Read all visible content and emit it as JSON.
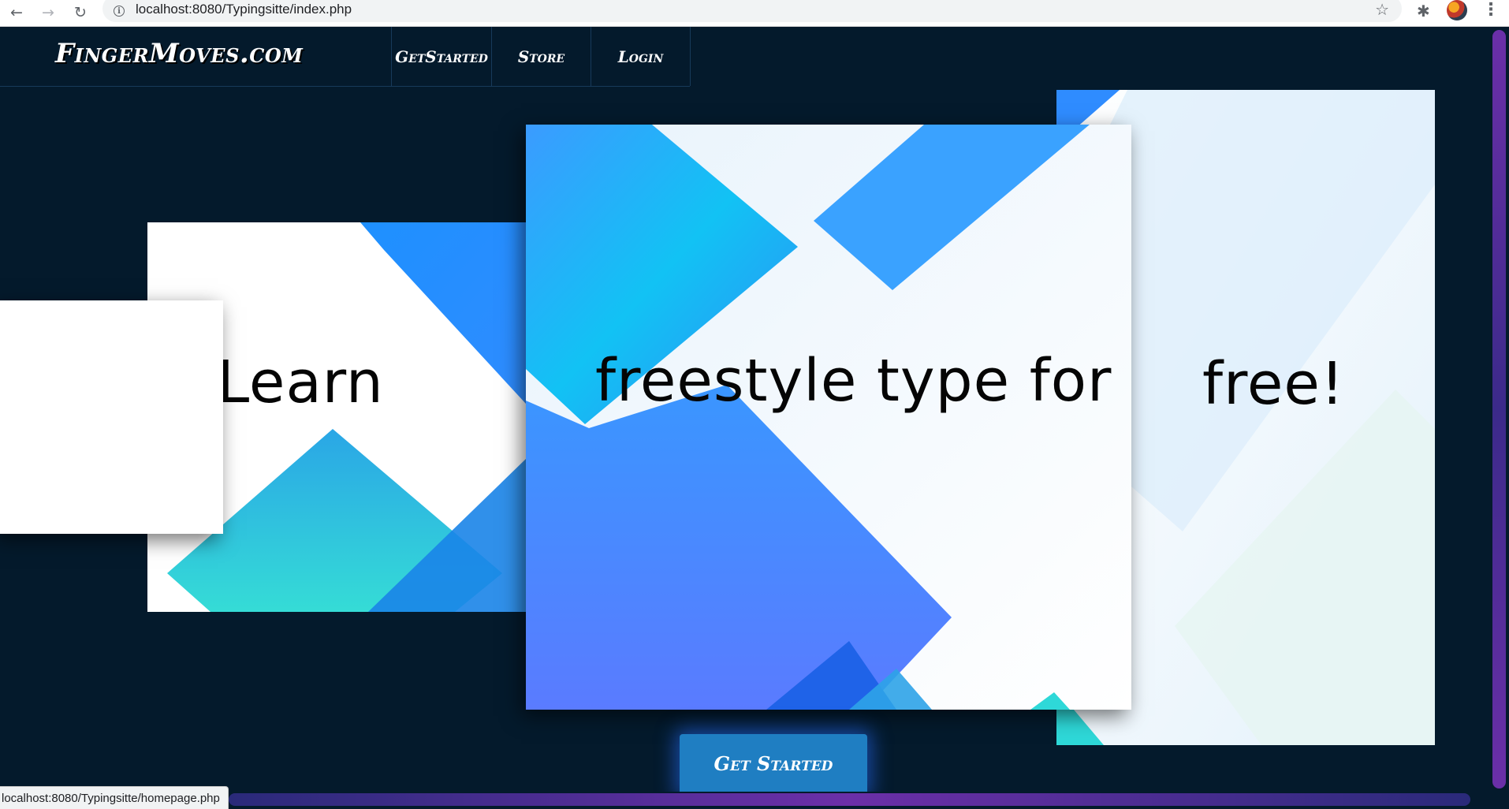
{
  "browser": {
    "url": "localhost:8080/Typingsitte/index.php",
    "status_url": "localhost:8080/Typingsitte/homepage.php"
  },
  "header": {
    "logo": "FingerMoves.com",
    "nav": [
      "GetStarted",
      "Store",
      "Login"
    ]
  },
  "hero": {
    "words": [
      "Learn",
      "freestyle type for",
      "free!"
    ],
    "cta_label": "Get Started"
  },
  "colors": {
    "background": "#041a2c",
    "cta": "#1f7ec2",
    "accent_blue": "#2f8cff",
    "accent_cyan": "#2ed8d8"
  }
}
